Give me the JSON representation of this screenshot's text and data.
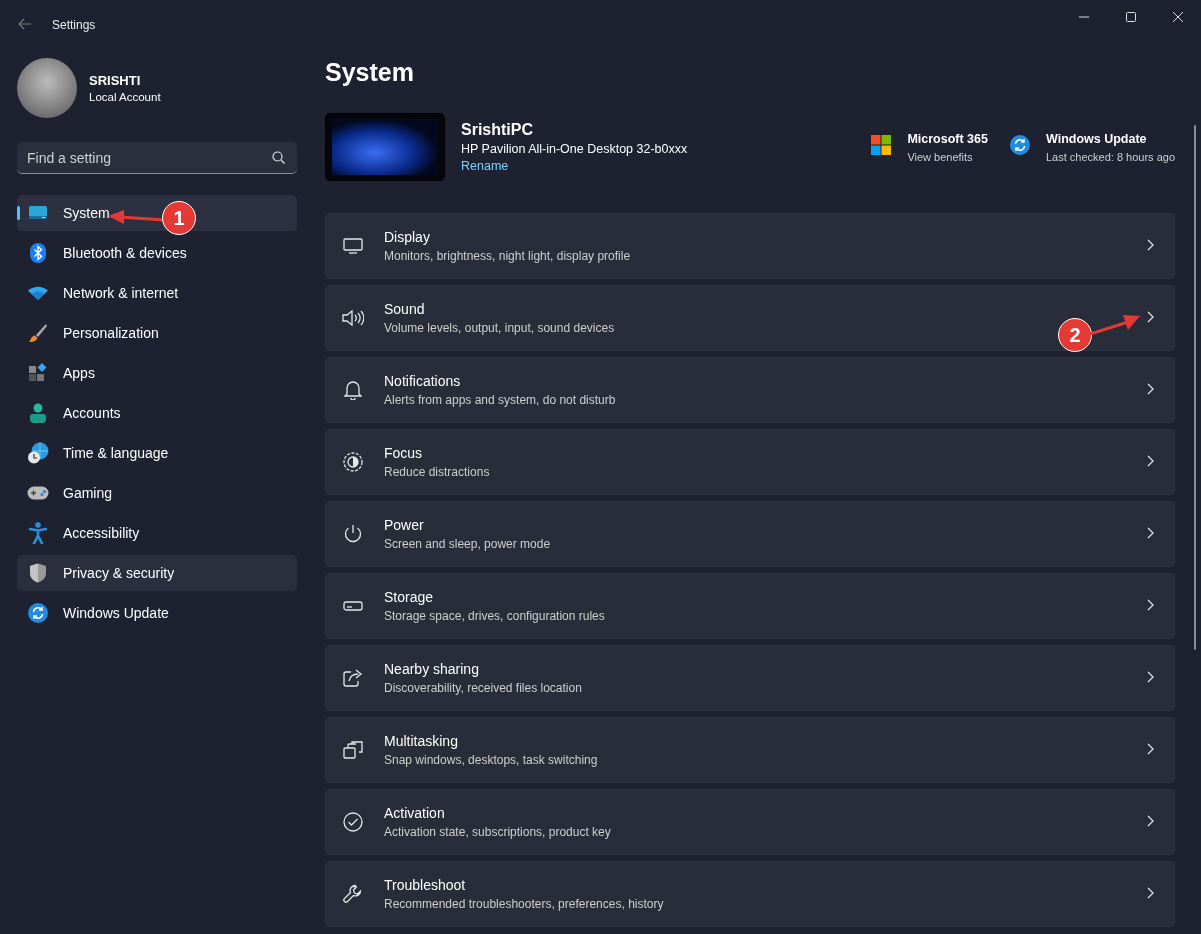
{
  "window": {
    "title": "Settings"
  },
  "profile": {
    "name": "SRISHTI",
    "account_type": "Local Account"
  },
  "search": {
    "placeholder": "Find a setting"
  },
  "sidebar": {
    "items": [
      {
        "label": "System",
        "selected": true,
        "highlighted": false
      },
      {
        "label": "Bluetooth & devices",
        "selected": false,
        "highlighted": false
      },
      {
        "label": "Network & internet",
        "selected": false,
        "highlighted": false
      },
      {
        "label": "Personalization",
        "selected": false,
        "highlighted": false
      },
      {
        "label": "Apps",
        "selected": false,
        "highlighted": false
      },
      {
        "label": "Accounts",
        "selected": false,
        "highlighted": false
      },
      {
        "label": "Time & language",
        "selected": false,
        "highlighted": false
      },
      {
        "label": "Gaming",
        "selected": false,
        "highlighted": false
      },
      {
        "label": "Accessibility",
        "selected": false,
        "highlighted": false
      },
      {
        "label": "Privacy & security",
        "selected": false,
        "highlighted": true
      },
      {
        "label": "Windows Update",
        "selected": false,
        "highlighted": false
      }
    ]
  },
  "page": {
    "title": "System"
  },
  "device": {
    "name": "SrishtiPC",
    "model": "HP Pavilion All-in-One Desktop 32-b0xxx",
    "rename_link": "Rename"
  },
  "quick_links": [
    {
      "title": "Microsoft 365",
      "subtitle": "View benefits"
    },
    {
      "title": "Windows Update",
      "subtitle": "Last checked: 8 hours ago"
    }
  ],
  "settings": [
    {
      "title": "Display",
      "subtitle": "Monitors, brightness, night light, display profile"
    },
    {
      "title": "Sound",
      "subtitle": "Volume levels, output, input, sound devices"
    },
    {
      "title": "Notifications",
      "subtitle": "Alerts from apps and system, do not disturb"
    },
    {
      "title": "Focus",
      "subtitle": "Reduce distractions"
    },
    {
      "title": "Power",
      "subtitle": "Screen and sleep, power mode"
    },
    {
      "title": "Storage",
      "subtitle": "Storage space, drives, configuration rules"
    },
    {
      "title": "Nearby sharing",
      "subtitle": "Discoverability, received files location"
    },
    {
      "title": "Multitasking",
      "subtitle": "Snap windows, desktops, task switching"
    },
    {
      "title": "Activation",
      "subtitle": "Activation state, subscriptions, product key"
    },
    {
      "title": "Troubleshoot",
      "subtitle": "Recommended troubleshooters, preferences, history"
    }
  ],
  "callouts": [
    {
      "label": "1"
    },
    {
      "label": "2"
    }
  ]
}
